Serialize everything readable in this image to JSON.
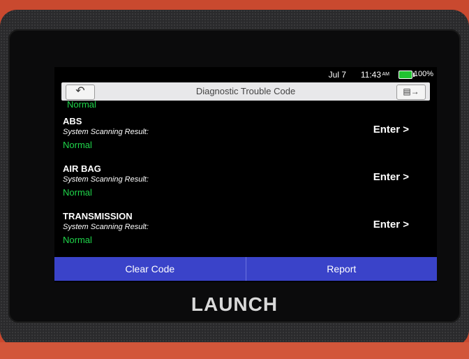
{
  "status_bar": {
    "date": "Jul 7",
    "time": "11:43",
    "ampm": "AM",
    "battery": "100%"
  },
  "header": {
    "title": "Diagnostic Trouble Code",
    "back_icon": "back-arrow-icon",
    "exit_icon": "exit-icon"
  },
  "previous_status": "Normal",
  "systems": [
    {
      "name": "ABS",
      "label": "System Scanning Result:",
      "status": "Normal",
      "enter": "Enter >"
    },
    {
      "name": "AIR BAG",
      "label": "System Scanning Result:",
      "status": "Normal",
      "enter": "Enter >"
    },
    {
      "name": "TRANSMISSION",
      "label": "System Scanning Result:",
      "status": "Normal",
      "enter": "Enter >"
    }
  ],
  "actions": {
    "clear_code": "Clear Code",
    "report": "Report"
  },
  "brand": "LAUNCH",
  "colors": {
    "status_green": "#1fd54a",
    "action_blue": "#3a43c9",
    "device_red": "#c9492f"
  }
}
